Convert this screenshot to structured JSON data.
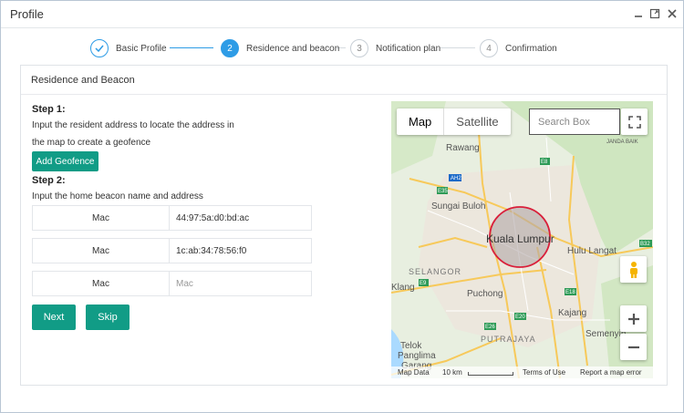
{
  "window": {
    "title": "Profile",
    "controls": [
      "minimize-icon",
      "maximize-icon",
      "close-icon"
    ]
  },
  "steps": [
    {
      "number": "1",
      "label": "Basic Profile",
      "state": "done"
    },
    {
      "number": "2",
      "label": "Residence and beacon",
      "state": "active"
    },
    {
      "number": "3",
      "label": "Notification plan",
      "state": "pending"
    },
    {
      "number": "4",
      "label": "Confirmation",
      "state": "pending"
    }
  ],
  "panel": {
    "title": "Residence and Beacon",
    "step1_label": "Step 1:",
    "step1_line1": "Input the resident address to locate the address in",
    "step1_line2": "the map to create a geofence",
    "add_geofence": "Add Geofence",
    "step2_label": "Step 2:",
    "step2_text": "Input the home beacon name and address",
    "beacons": [
      {
        "name": "Mac",
        "address": "44:97:5a:d0:bd:ac",
        "placeholder": "Mac"
      },
      {
        "name": "Mac",
        "address": "1c:ab:34:78:56:f0",
        "placeholder": "Mac"
      },
      {
        "name": "Mac",
        "address": "",
        "placeholder": "Mac"
      }
    ],
    "next": "Next",
    "skip": "Skip"
  },
  "map": {
    "tab_map": "Map",
    "tab_satellite": "Satellite",
    "search_placeholder": "Search Box",
    "places": {
      "rawang": "Rawang",
      "sungai_buloh": "Sungai Buloh",
      "kuala_lumpur": "Kuala Lumpur",
      "hulu_langat": "Hulu Langat",
      "selangor": "SELANGOR",
      "klang": "Klang",
      "puchong": "Puchong",
      "kajang": "Kajang",
      "semenyih": "Semenyih",
      "telok_panglima": "Telok",
      "panglima_garang": "Panglima",
      "garang": "Garang",
      "putrajaya": "PUTRAJAYA",
      "janda_baik": "JANDA BAIK"
    },
    "shields": [
      "AH2",
      "E35",
      "E8",
      "B32",
      "E9",
      "E18",
      "E20",
      "E26",
      "E6",
      "E8"
    ],
    "footer_map_data": "Map Data",
    "footer_scale": "10 km",
    "footer_terms": "Terms of Use",
    "footer_report": "Report a map error",
    "geofence_color": "#d91f3a",
    "accent": "#2e9ce6",
    "button_color": "#119c86"
  }
}
